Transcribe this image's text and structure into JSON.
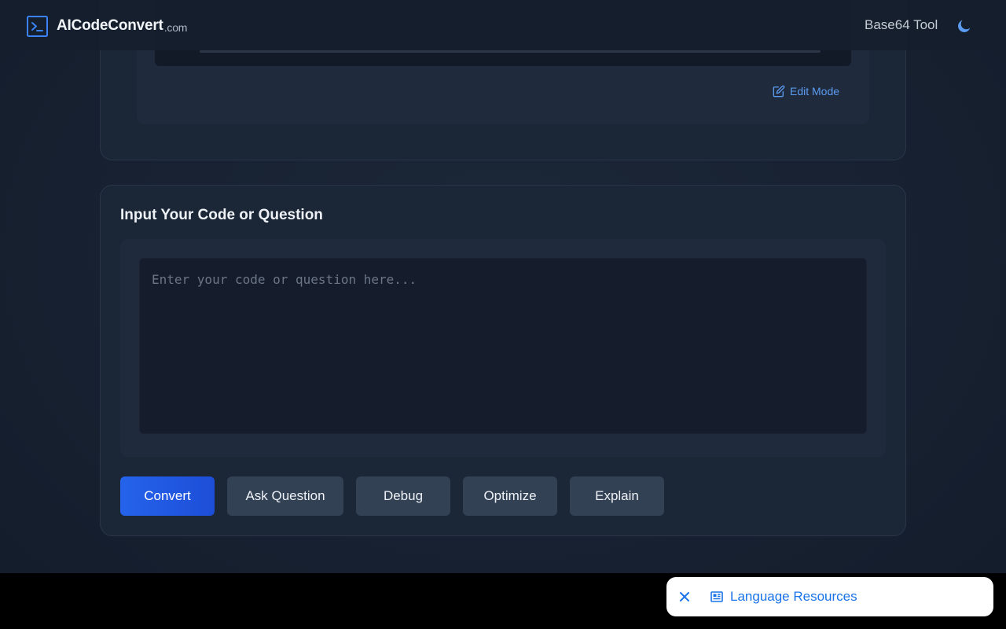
{
  "header": {
    "logo_text": "AICodeConvert",
    "logo_suffix": ".com",
    "nav_link": "Base64 Tool",
    "icons": {
      "logo": "terminal-icon",
      "theme": "moon-icon"
    }
  },
  "previous_card": {
    "edit_mode_label": "Edit Mode",
    "icon": "edit-icon"
  },
  "input_card": {
    "title": "Input Your Code or Question",
    "placeholder": "Enter your code or question here...",
    "value": "",
    "buttons": {
      "convert": "Convert",
      "ask": "Ask Question",
      "debug": "Debug",
      "optimize": "Optimize",
      "explain": "Explain"
    }
  },
  "ad_bar": {
    "label": "Language Resources",
    "icons": {
      "close": "close-icon",
      "resource": "newspaper-icon"
    }
  },
  "colors": {
    "accent": "#2563eb",
    "link": "#5b9cf0",
    "ad_link": "#1a73e8",
    "secondary_button": "#334155"
  }
}
